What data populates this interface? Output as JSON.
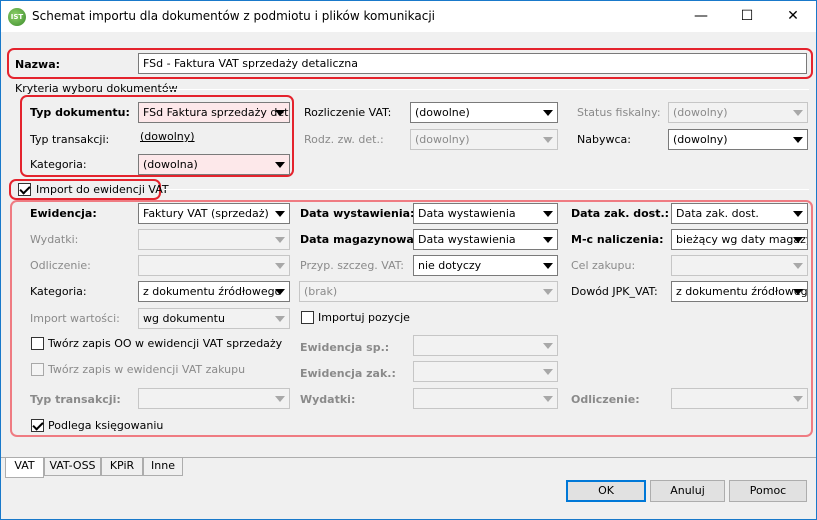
{
  "window": {
    "title": "Schemat importu dla dokumentów z podmiotu i plików komunikacji",
    "app_icon_text": "IST",
    "minimize_glyph": "—",
    "maximize_glyph": "☐",
    "close_glyph": "✕"
  },
  "name": {
    "label": "Nazwa:",
    "value": "FSd - Faktura VAT sprzedaży detaliczna"
  },
  "criteria": {
    "group_label": "Kryteria wyboru dokumentów",
    "doc_type": {
      "label": "Typ dokumentu:",
      "value": "FSd Faktura sprzedaży det"
    },
    "vat_settlement": {
      "label": "Rozliczenie VAT:",
      "value": "(dowolne)"
    },
    "fiscal_status": {
      "label": "Status fiskalny:",
      "value": "(dowolny)"
    },
    "transaction_type": {
      "label": "Typ transakcji:",
      "value": "(dowolny)"
    },
    "detail_type": {
      "label": "Rodz. zw. det.:",
      "value": "(dowolny)"
    },
    "buyer": {
      "label": "Nabywca:",
      "value": "(dowolny)"
    },
    "category": {
      "label": "Kategoria:",
      "value": "(dowolna)"
    }
  },
  "vat_import": {
    "checkbox_label": "Import do ewidencji VAT",
    "checked": true,
    "register": {
      "label": "Ewidencja:",
      "value": "Faktury VAT (sprzedaż)"
    },
    "issue_date": {
      "label": "Data wystawienia:",
      "value": "Data wystawienia"
    },
    "purchase_date": {
      "label": "Data zak. dost.:",
      "value": "Data zak. dost."
    },
    "expenses": {
      "label": "Wydatki:",
      "value": ""
    },
    "warehouse_date": {
      "label": "Data magazynowa:",
      "value": "Data wystawienia"
    },
    "accrual_month": {
      "label": "M-c naliczenia:",
      "value": "bieżący wg daty magazy"
    },
    "deduction": {
      "label": "Odliczenie:",
      "value": ""
    },
    "vat_special_rule": {
      "label": "Przyp. szczeg. VAT:",
      "value": "nie dotyczy"
    },
    "purchase_purpose": {
      "label": "Cel zakupu:",
      "value": ""
    },
    "category": {
      "label": "Kategoria:",
      "value": "z dokumentu źródłowego"
    },
    "category2": {
      "value": "(brak)"
    },
    "jpk_doc": {
      "label": "Dowód JPK_VAT:",
      "value": "z dokumentu źródłowego"
    },
    "value_import": {
      "label": "Import wartości:",
      "value": "wg dokumentu"
    },
    "import_items": {
      "label": "Importuj pozycje",
      "checked": false
    },
    "create_oo_sales": {
      "label": "Twórz zapis OO w ewidencji VAT sprzedaży",
      "checked": false
    },
    "sales_register": {
      "label": "Ewidencja sp.:",
      "value": ""
    },
    "create_purchase": {
      "label": "Twórz zapis w ewidencji VAT zakupu",
      "checked": false
    },
    "purchase_register": {
      "label": "Ewidencja zak.:",
      "value": ""
    },
    "transaction_type": {
      "label": "Typ transakcji:",
      "value": ""
    },
    "expenses2": {
      "label": "Wydatki:",
      "value": ""
    },
    "deduction2": {
      "label": "Odliczenie:",
      "value": ""
    },
    "subject_to_posting": {
      "label": "Podlega księgowaniu",
      "checked": true
    }
  },
  "tabs": [
    {
      "label": "VAT",
      "active": true
    },
    {
      "label": "VAT-OSS",
      "active": false
    },
    {
      "label": "KPiR",
      "active": false
    },
    {
      "label": "Inne",
      "active": false
    }
  ],
  "buttons": {
    "ok": "OK",
    "cancel": "Anuluj",
    "help": "Pomoc"
  },
  "colors": {
    "highlight": "#e4232d",
    "focus_bg": "#fde8ea",
    "title_border": "#1979ca"
  }
}
